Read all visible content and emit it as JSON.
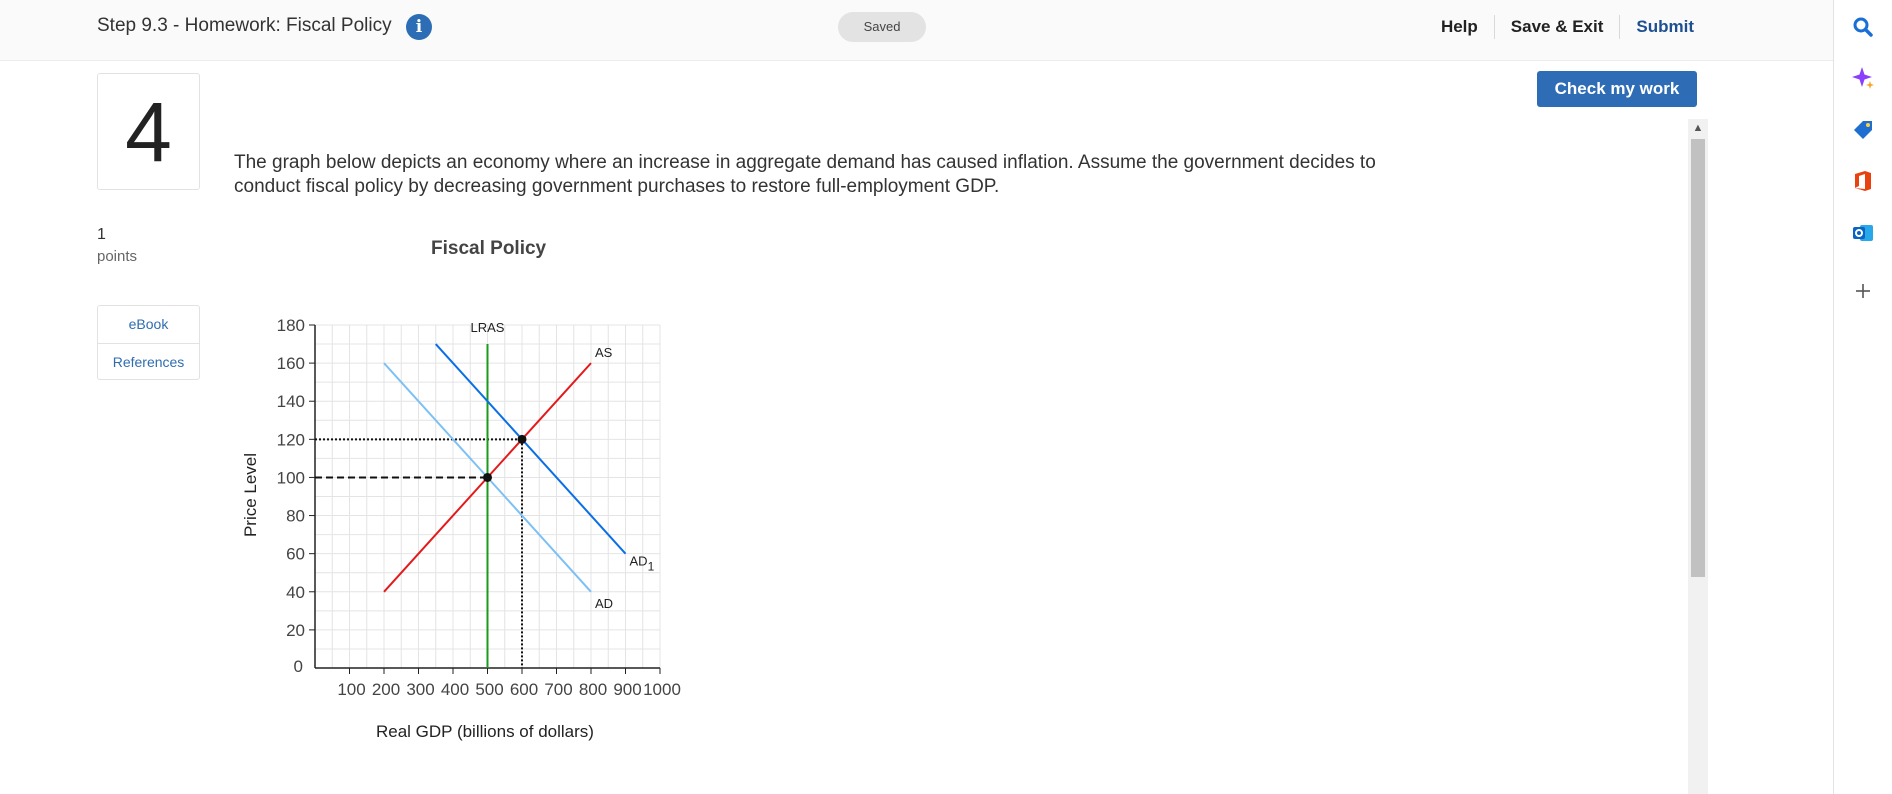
{
  "header": {
    "title": "Step 9.3 - Homework: Fiscal Policy",
    "saved_label": "Saved",
    "help_label": "Help",
    "save_exit_label": "Save & Exit",
    "submit_label": "Submit"
  },
  "question": {
    "number": "4",
    "points_value": "1",
    "points_label": "points",
    "ebook_label": "eBook",
    "references_label": "References",
    "check_label": "Check my work",
    "text": "The graph below depicts an economy where an increase in aggregate demand has caused inflation. Assume the government decides to conduct fiscal policy by decreasing government purchases to restore full-employment GDP."
  },
  "side_rail": {
    "icons": [
      "search-icon",
      "copilot-sparkle-icon",
      "shopping-tag-icon",
      "office-icon",
      "outlook-icon",
      "add-icon"
    ]
  },
  "colors": {
    "accent": "#2e6db5",
    "as_curve": "#e31a1c",
    "ad_curve": "#7cc0f5",
    "ad1_curve": "#0a6fe6",
    "lras_curve": "#1a9a1a"
  },
  "chart_data": {
    "type": "line",
    "title": "Fiscal Policy",
    "xlabel": "Real GDP (billions of dollars)",
    "ylabel": "Price Level",
    "xlim": [
      0,
      1000
    ],
    "ylim": [
      0,
      180
    ],
    "xticks": [
      100,
      200,
      300,
      400,
      500,
      600,
      700,
      800,
      900,
      1000
    ],
    "yticks": [
      0,
      20,
      40,
      60,
      80,
      100,
      120,
      140,
      160,
      180
    ],
    "grid": true,
    "series": [
      {
        "name": "LRAS",
        "x": [
          500,
          500
        ],
        "y": [
          0,
          170
        ]
      },
      {
        "name": "AS",
        "x": [
          200,
          800
        ],
        "y": [
          40,
          160
        ]
      },
      {
        "name": "AD",
        "x": [
          200,
          800
        ],
        "y": [
          160,
          40
        ]
      },
      {
        "name": "AD",
        "sub": "1",
        "x": [
          350,
          900
        ],
        "y": [
          170,
          60
        ]
      }
    ],
    "points": [
      {
        "x": 500,
        "y": 100
      },
      {
        "x": 600,
        "y": 120
      }
    ],
    "guides": [
      {
        "style": "dashed",
        "x": 500,
        "y": 100
      },
      {
        "style": "dotted",
        "x": 600,
        "y": 120
      }
    ]
  }
}
